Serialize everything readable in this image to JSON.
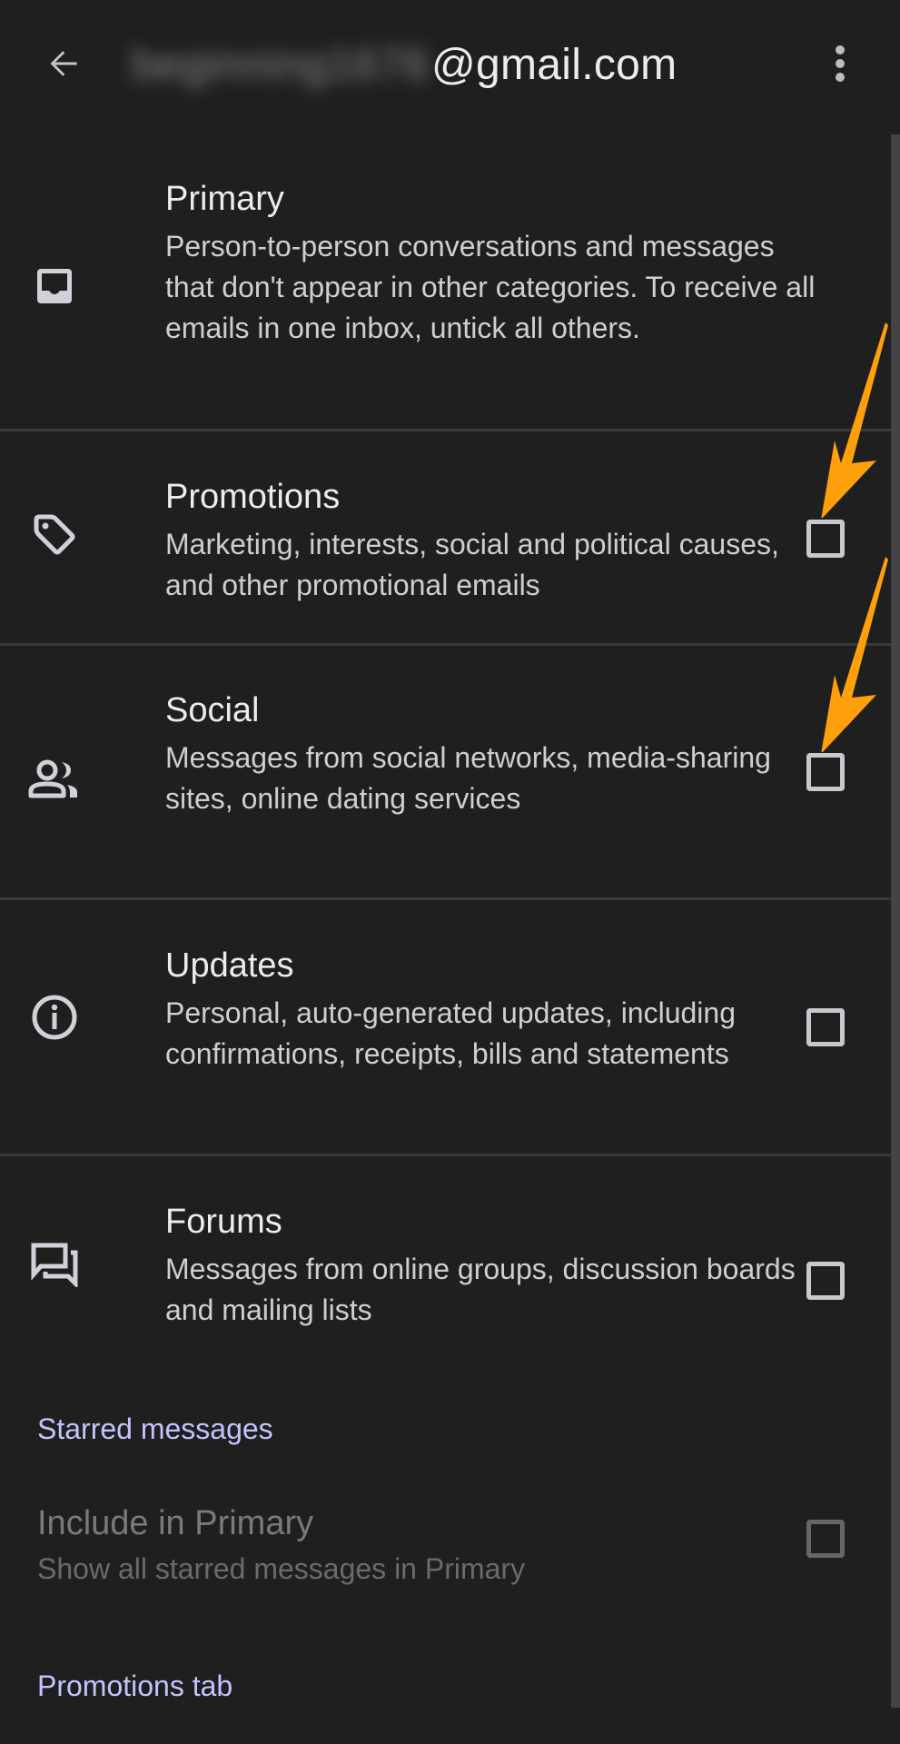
{
  "appbar": {
    "account_blurred": "beginning1676",
    "account_domain": "@gmail.com",
    "back_icon": "arrow-left-icon",
    "more_icon": "more-vert-icon"
  },
  "categories": [
    {
      "id": "primary",
      "icon": "inbox-icon",
      "title": "Primary",
      "description": "Person-to-person conversations and messages that don't appear in other categories. To receive all emails in one inbox, untick all others.",
      "has_checkbox": false
    },
    {
      "id": "promotions",
      "icon": "tag-icon",
      "title": "Promotions",
      "description": "Marketing, interests, social and political causes, and other promotional emails",
      "has_checkbox": true,
      "checked": false
    },
    {
      "id": "social",
      "icon": "people-icon",
      "title": "Social",
      "description": "Messages from social networks, media-sharing sites, online dating services",
      "has_checkbox": true,
      "checked": false
    },
    {
      "id": "updates",
      "icon": "info-icon",
      "title": "Updates",
      "description": "Personal, auto-generated updates, including confirmations, receipts, bills and statements",
      "has_checkbox": true,
      "checked": false
    },
    {
      "id": "forums",
      "icon": "forum-icon",
      "title": "Forums",
      "description": "Messages from online groups, discussion boards and mailing lists",
      "has_checkbox": true,
      "checked": false
    }
  ],
  "starred_section": {
    "header": "Starred messages",
    "item": {
      "title": "Include in Primary",
      "description": "Show all starred messages in Primary",
      "checked": false,
      "disabled": true
    }
  },
  "promotions_tab_section": {
    "header": "Promotions tab"
  },
  "annotations": {
    "arrow_color": "#ff9f0a",
    "arrows_point_to": [
      "promotions-checkbox",
      "social-checkbox"
    ]
  },
  "colors": {
    "background": "#1f1f1f",
    "section_header": "#c5c3ff",
    "divider": "#3a3a3a"
  }
}
